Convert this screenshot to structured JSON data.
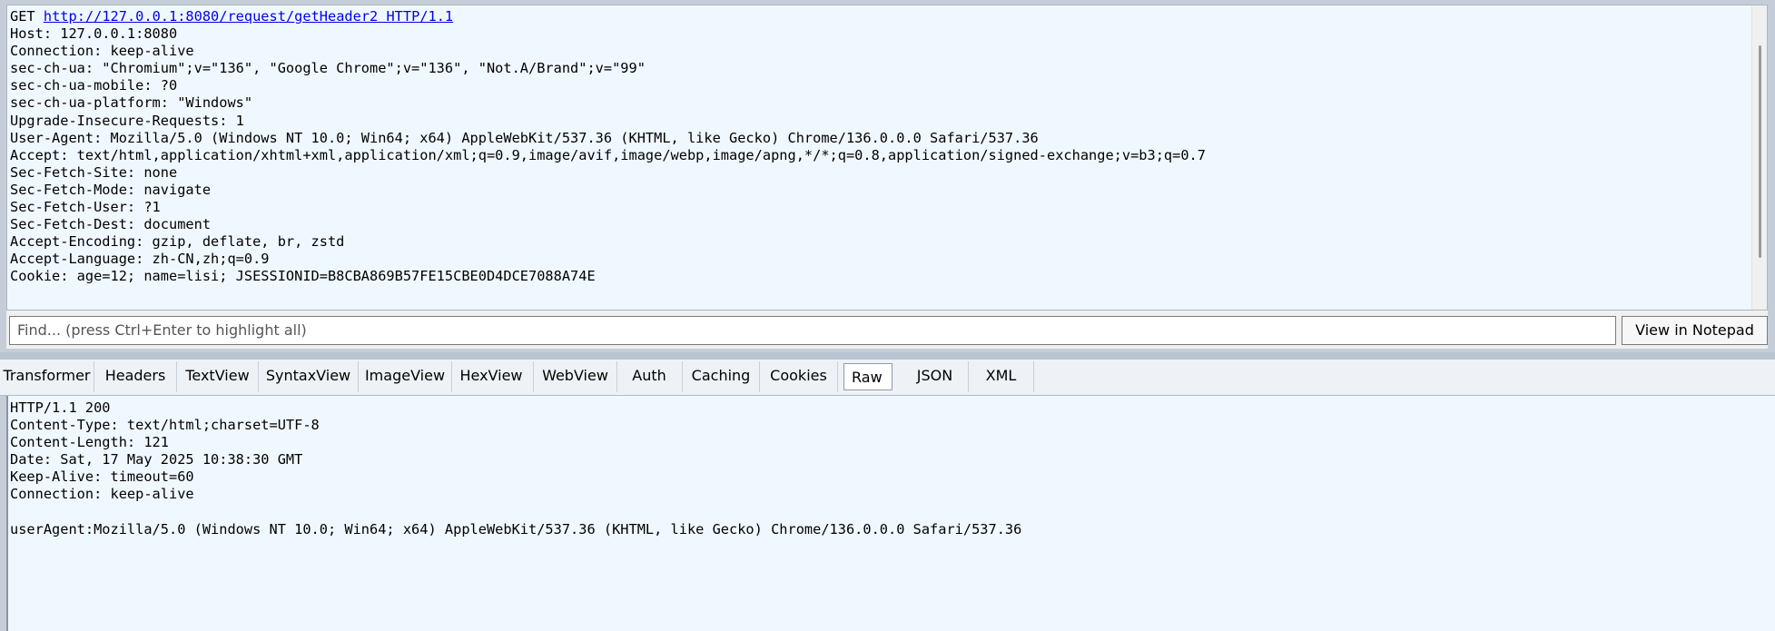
{
  "request": {
    "method": "GET",
    "url": "http://127.0.0.1:8080/request/getHeader2",
    "protocol": "HTTP/1.1",
    "headers": [
      "Host: 127.0.0.1:8080",
      "Connection: keep-alive",
      "sec-ch-ua: \"Chromium\";v=\"136\", \"Google Chrome\";v=\"136\", \"Not.A/Brand\";v=\"99\"",
      "sec-ch-ua-mobile: ?0",
      "sec-ch-ua-platform: \"Windows\"",
      "Upgrade-Insecure-Requests: 1",
      "User-Agent: Mozilla/5.0 (Windows NT 10.0; Win64; x64) AppleWebKit/537.36 (KHTML, like Gecko) Chrome/136.0.0.0 Safari/537.36",
      "Accept: text/html,application/xhtml+xml,application/xml;q=0.9,image/avif,image/webp,image/apng,*/*;q=0.8,application/signed-exchange;v=b3;q=0.7",
      "Sec-Fetch-Site: none",
      "Sec-Fetch-Mode: navigate",
      "Sec-Fetch-User: ?1",
      "Sec-Fetch-Dest: document",
      "Accept-Encoding: gzip, deflate, br, zstd",
      "Accept-Language: zh-CN,zh;q=0.9",
      "Cookie: age=12; name=lisi; JSESSIONID=B8CBA869B57FE15CBE0D4DCE7088A74E"
    ]
  },
  "find": {
    "placeholder": "Find... (press Ctrl+Enter to highlight all)",
    "view_in_notepad_label": "View in Notepad"
  },
  "tabs": [
    {
      "label": "Transformer"
    },
    {
      "label": "Headers"
    },
    {
      "label": "TextView"
    },
    {
      "label": "SyntaxView"
    },
    {
      "label": "ImageView"
    },
    {
      "label": "HexView"
    },
    {
      "label": "WebView"
    },
    {
      "label": "Auth"
    },
    {
      "label": "Caching"
    },
    {
      "label": "Cookies"
    },
    {
      "label": "Raw",
      "active": true
    },
    {
      "label": "JSON"
    },
    {
      "label": "XML"
    }
  ],
  "response": {
    "lines": [
      "HTTP/1.1 200",
      "Content-Type: text/html;charset=UTF-8",
      "Content-Length: 121",
      "Date: Sat, 17 May 2025 10:38:30 GMT",
      "Keep-Alive: timeout=60",
      "Connection: keep-alive",
      "",
      "userAgent:Mozilla/5.0 (Windows NT 10.0; Win64; x64) AppleWebKit/537.36 (KHTML, like Gecko) Chrome/136.0.0.0 Safari/537.36"
    ]
  },
  "colors": {
    "pane_background": "#f0f8ff",
    "link": "#0000ee"
  }
}
